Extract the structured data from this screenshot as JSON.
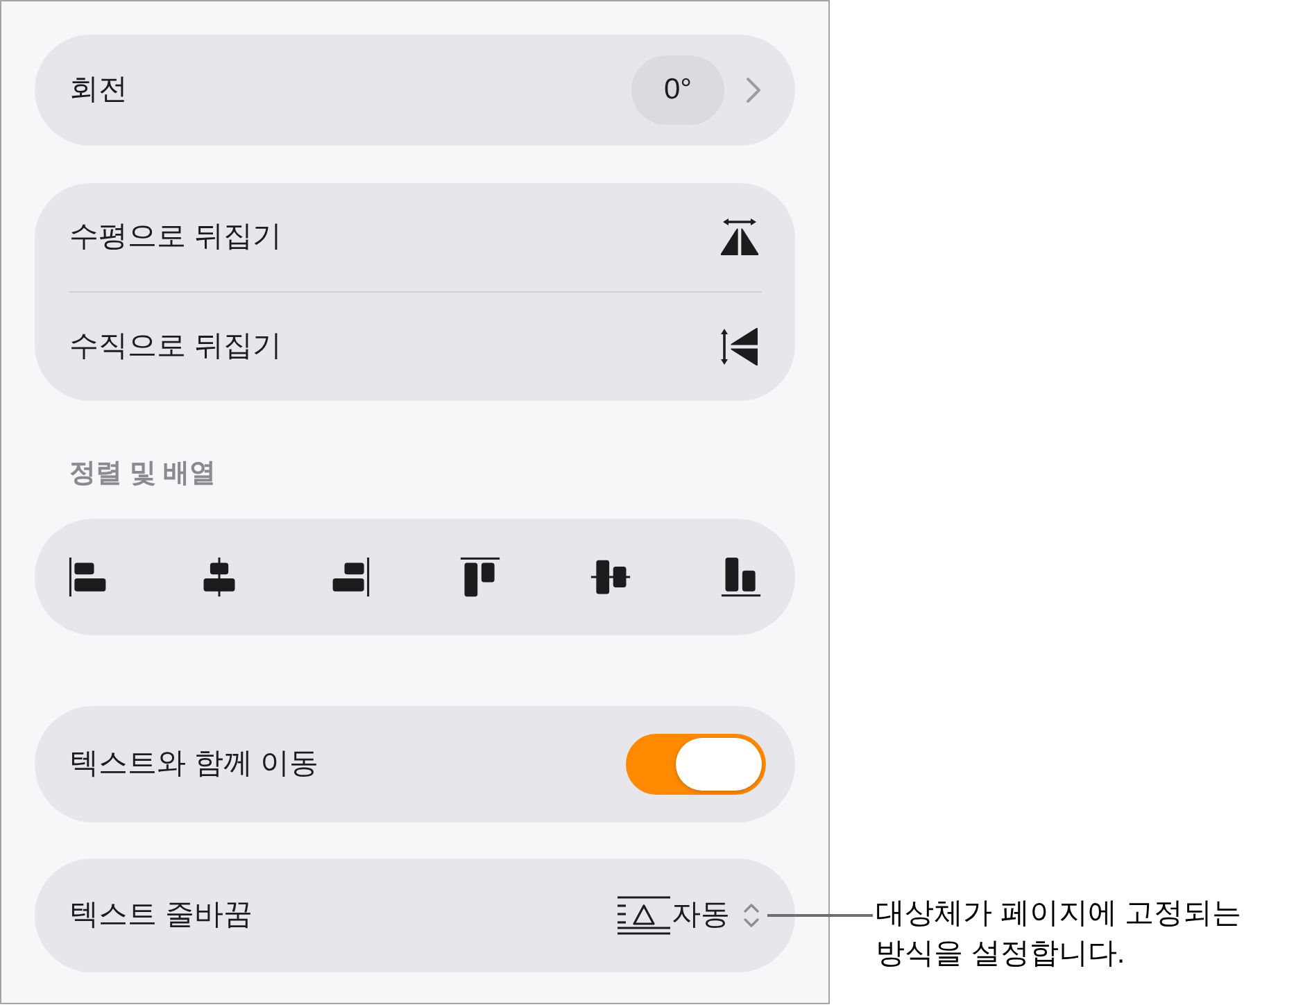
{
  "rotation": {
    "label": "회전",
    "value": "0°"
  },
  "flip": [
    {
      "label": "수평으로 뒤집기",
      "kind": "horizontal"
    },
    {
      "label": "수직으로 뒤집기",
      "kind": "vertical"
    }
  ],
  "arrange": {
    "heading": "정렬 및 배열",
    "buttons": [
      {
        "kind": "left"
      },
      {
        "kind": "center"
      },
      {
        "kind": "right"
      },
      {
        "kind": "top"
      },
      {
        "kind": "middle"
      },
      {
        "kind": "bottom"
      }
    ]
  },
  "move_with_text": {
    "label": "텍스트와 함께 이동",
    "on": true
  },
  "text_wrap": {
    "label": "텍스트 줄바꿈",
    "value": "자동"
  },
  "callout": "대상체가 페이지에 고정되는 방식을 설정합니다."
}
